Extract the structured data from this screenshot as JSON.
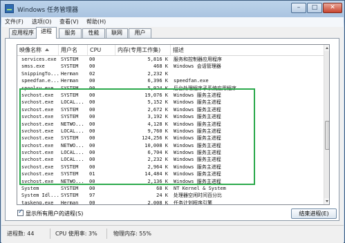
{
  "window": {
    "title": "Windows 任务管理器",
    "controls": {
      "minimize": "–",
      "maximize": "□",
      "close": "✕"
    }
  },
  "menu": [
    "文件(F)",
    "选项(O)",
    "查看(V)",
    "帮助(H)"
  ],
  "tabs": [
    "应用程序",
    "进程",
    "服务",
    "性能",
    "联网",
    "用户"
  ],
  "active_tab": "进程",
  "columns": [
    "映像名称",
    "用户名",
    "CPU",
    "内存(专用工作集)",
    "描述"
  ],
  "processes": [
    {
      "name": "services.exe",
      "user": "SYSTEM",
      "cpu": "00",
      "mem": "5,816 K",
      "desc": "服务和控制器应用程序"
    },
    {
      "name": "smss.exe",
      "user": "SYSTEM",
      "cpu": "00",
      "mem": "468 K",
      "desc": "Windows 会话管理器"
    },
    {
      "name": "SnippingTo...",
      "user": "Herman",
      "cpu": "02",
      "mem": "2,232 K",
      "desc": ""
    },
    {
      "name": "speedfan.e...",
      "user": "Herman",
      "cpu": "00",
      "mem": "6,396 K",
      "desc": "speedfan.exe"
    },
    {
      "name": "spoolsv.exe",
      "user": "SYSTEM",
      "cpu": "00",
      "mem": "5,924 K",
      "desc": "后台处理程序子系统应用程序"
    },
    {
      "name": "svchost.exe",
      "user": "SYSTEM",
      "cpu": "00",
      "mem": "19,076 K",
      "desc": "Windows 服务主进程"
    },
    {
      "name": "svchost.exe",
      "user": "LOCAL...",
      "cpu": "00",
      "mem": "5,152 K",
      "desc": "Windows 服务主进程"
    },
    {
      "name": "svchost.exe",
      "user": "SYSTEM",
      "cpu": "00",
      "mem": "2,672 K",
      "desc": "Windows 服务主进程"
    },
    {
      "name": "svchost.exe",
      "user": "SYSTEM",
      "cpu": "00",
      "mem": "3,192 K",
      "desc": "Windows 服务主进程"
    },
    {
      "name": "svchost.exe",
      "user": "NETWO...",
      "cpu": "00",
      "mem": "4,128 K",
      "desc": "Windows 服务主进程"
    },
    {
      "name": "svchost.exe",
      "user": "LOCAL...",
      "cpu": "00",
      "mem": "9,760 K",
      "desc": "Windows 服务主进程"
    },
    {
      "name": "svchost.exe",
      "user": "SYSTEM",
      "cpu": "00",
      "mem": "124,256 K",
      "desc": "Windows 服务主进程"
    },
    {
      "name": "svchost.exe",
      "user": "NETWO...",
      "cpu": "00",
      "mem": "10,008 K",
      "desc": "Windows 服务主进程"
    },
    {
      "name": "svchost.exe",
      "user": "LOCAL...",
      "cpu": "00",
      "mem": "6,704 K",
      "desc": "Windows 服务主进程"
    },
    {
      "name": "svchost.exe",
      "user": "LOCAL...",
      "cpu": "00",
      "mem": "2,232 K",
      "desc": "Windows 服务主进程"
    },
    {
      "name": "svchost.exe",
      "user": "SYSTEM",
      "cpu": "00",
      "mem": "2,964 K",
      "desc": "Windows 服务主进程"
    },
    {
      "name": "svchost.exe",
      "user": "SYSTEM",
      "cpu": "01",
      "mem": "14,484 K",
      "desc": "Windows 服务主进程"
    },
    {
      "name": "svchost.exe",
      "user": "NETWO...",
      "cpu": "00",
      "mem": "2,136 K",
      "desc": "Windows 服务主进程"
    },
    {
      "name": "System",
      "user": "SYSTEM",
      "cpu": "00",
      "mem": "68 K",
      "desc": "NT Kernel & System"
    },
    {
      "name": "System Idl...",
      "user": "SYSTEM",
      "cpu": "97",
      "mem": "24 K",
      "desc": "处理器空闲时间百分比"
    },
    {
      "name": "taskeng.exe",
      "user": "Herman",
      "cpu": "00",
      "mem": "2,008 K",
      "desc": "任务计划程序引擎"
    }
  ],
  "show_all_label": "显示所有用户的进程(S)",
  "end_process_label": "结束进程(E)",
  "status": {
    "processes": "进程数: 44",
    "cpu": "CPU 使用率: 3%",
    "memory": "物理内存: 55%"
  },
  "colors": {
    "highlight": "#2aa84a",
    "titlebar": "#a6c0de"
  }
}
